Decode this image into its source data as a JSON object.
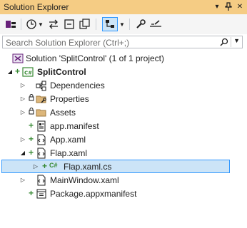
{
  "panel": {
    "title": "Solution Explorer",
    "pin_glyph": "▾",
    "autohide_glyph": "⊥",
    "close_glyph": "✕"
  },
  "search": {
    "placeholder": "Search Solution Explorer (Ctrl+;)"
  },
  "tree": {
    "solution": "Solution 'SplitControl' (1 of 1 project)",
    "project": "SplitControl",
    "dependencies": "Dependencies",
    "properties": "Properties",
    "assets": "Assets",
    "app_manifest": "app.manifest",
    "app_xaml": "App.xaml",
    "flap_xaml": "Flap.xaml",
    "flap_xaml_cs": "Flap.xaml.cs",
    "mainwindow_xaml": "MainWindow.xaml",
    "package_manifest": "Package.appxmanifest"
  },
  "badges": {
    "csharp": "C#"
  },
  "colors": {
    "title_bar": "#f5cc84",
    "toolbar": "#f5f5f5",
    "selection_bg": "#cce4f7",
    "selection_border": "#3399ff",
    "add_green": "#388a34",
    "vs_purple": "#68217a"
  }
}
